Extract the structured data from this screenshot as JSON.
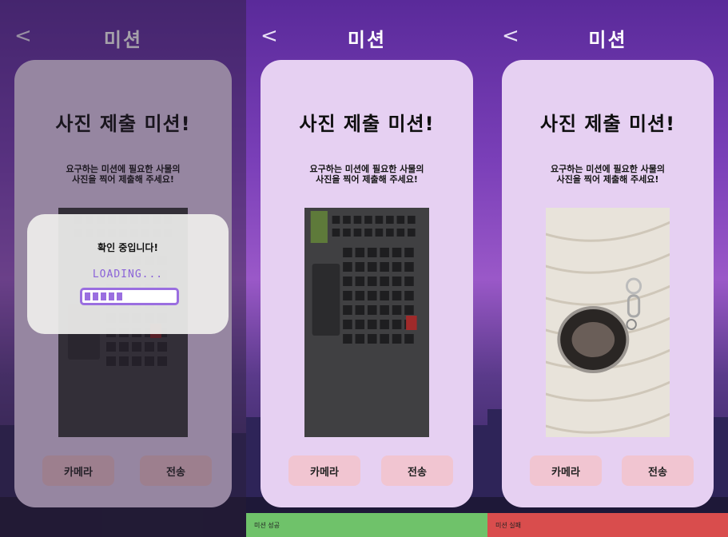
{
  "colors": {
    "success_toast": "#6fc26a",
    "fail_toast": "#d94d4d",
    "card": "#e6d0f2",
    "button": "#f1c5d1",
    "loading": "#9a6ee0"
  },
  "screens": [
    {
      "header": {
        "back_icon": "chevron-left-icon",
        "back": "<",
        "title": "미션"
      },
      "card": {
        "heading": "사진 제출 미션!",
        "desc_line1": "요구하는 미션에 필요한 사물의",
        "desc_line2": "사진을 찍어 제출해 주세요!",
        "photo": "keyboard-photo"
      },
      "buttons": {
        "camera": "카메라",
        "send": "전송"
      },
      "modal": {
        "message": "확인 중입니다!",
        "loading": "LOADING...",
        "progress": 0.45
      }
    },
    {
      "header": {
        "back_icon": "chevron-left-icon",
        "back": "<",
        "title": "미션"
      },
      "card": {
        "heading": "사진 제출 미션!",
        "desc_line1": "요구하는 미션에 필요한 사물의",
        "desc_line2": "사진을 찍어 제출해 주세요!",
        "photo": "keyboard-photo"
      },
      "buttons": {
        "camera": "카메라",
        "send": "전송"
      },
      "toast": {
        "text": "미션 성공"
      }
    },
    {
      "header": {
        "back_icon": "chevron-left-icon",
        "back": "<",
        "title": "미션"
      },
      "card": {
        "heading": "사진 제출 미션!",
        "desc_line1": "요구하는 미션에 필요한 사물의",
        "desc_line2": "사진을 찍어 제출해 주세요!",
        "photo": "keychain-photo"
      },
      "buttons": {
        "camera": "카메라",
        "send": "전송"
      },
      "toast": {
        "text": "미션 실패"
      }
    }
  ]
}
